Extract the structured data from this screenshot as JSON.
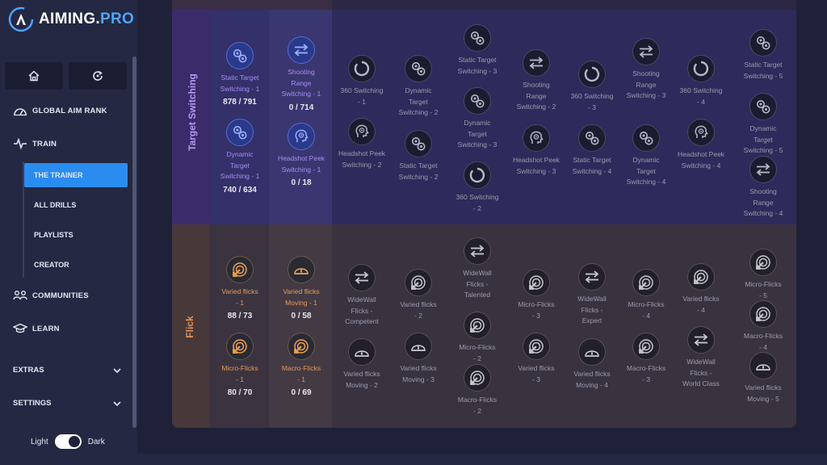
{
  "brand": {
    "name": "AIMING.",
    "suffix": "PRO"
  },
  "nav": {
    "global_aim_rank": "GLOBAL AIM RANK",
    "train": "TRAIN",
    "the_trainer": "THE TRAINER",
    "all_drills": "ALL DRILLS",
    "playlists": "PLAYLISTS",
    "creator": "CREATOR",
    "communities": "COMMUNITIES",
    "learn": "LEARN",
    "extras": "EXTRAS",
    "settings": "SETTINGS"
  },
  "theme": {
    "light": "Light",
    "dark": "Dark"
  },
  "rows": {
    "target_switching": "Target Switching",
    "flick": "Flick"
  },
  "drills": {
    "ts1": {
      "name": "Static Target Switching - 1",
      "score": "878 / 791"
    },
    "ts2": {
      "name": "Dynamic Target Switching - 1",
      "score": "740 / 634"
    },
    "ts3": {
      "name": "Shooting Range Switching - 1",
      "score": "0 / 714"
    },
    "ts4": {
      "name": "Headshot Peek Switching - 1",
      "score": "0 / 18"
    },
    "ts5": {
      "name": "360 Switching - 1"
    },
    "ts6": {
      "name": "Headshot Peek Switching - 2"
    },
    "ts7": {
      "name": "Dynamic Target Switching - 2"
    },
    "ts8": {
      "name": "Static Target Switching - 2"
    },
    "ts9": {
      "name": "Static Target Switching - 3"
    },
    "ts10": {
      "name": "Dynamic Target Switching - 3"
    },
    "ts11": {
      "name": "360 Switching - 2"
    },
    "ts12": {
      "name": "Shooting Range Switching - 2"
    },
    "ts13": {
      "name": "Headshot Peek Switching - 3"
    },
    "ts14": {
      "name": "360 Switching - 3"
    },
    "ts15": {
      "name": "Static Target Switching - 4"
    },
    "ts16": {
      "name": "Shooting Range Switching - 3"
    },
    "ts17": {
      "name": "Dynamic Target Switching - 4"
    },
    "ts18": {
      "name": "360 Switching - 4"
    },
    "ts19": {
      "name": "Headshot Peek Switching - 4"
    },
    "ts20": {
      "name": "Static Target Switching - 5"
    },
    "ts21": {
      "name": "Dynamic Target Switching - 5"
    },
    "ts22": {
      "name": "Shooting Range Switching - 4"
    },
    "fl1": {
      "name": "Varied flicks - 1",
      "score": "88 / 73"
    },
    "fl2": {
      "name": "Micro-Flicks - 1",
      "score": "80 / 70"
    },
    "fl3": {
      "name": "Varied flicks Moving - 1",
      "score": "0 / 58"
    },
    "fl4": {
      "name": "Macro-Flicks - 1",
      "score": "0 / 69"
    },
    "fl5": {
      "name": "WideWall Flicks - Competent"
    },
    "fl6": {
      "name": "Varied flicks Moving - 2"
    },
    "fl7": {
      "name": "Varied flicks - 2"
    },
    "fl8": {
      "name": "Varied flicks Moving - 3"
    },
    "fl9": {
      "name": "WideWall Flicks - Talented"
    },
    "fl10": {
      "name": "Micro-Flicks - 2"
    },
    "fl11": {
      "name": "Macro-Flicks - 2"
    },
    "fl12": {
      "name": "Micro-Flicks - 3"
    },
    "fl13": {
      "name": "Varied flicks - 3"
    },
    "fl14": {
      "name": "WideWall Flicks - Expert"
    },
    "fl15": {
      "name": "Varied flicks Moving - 4"
    },
    "fl16": {
      "name": "Micro-Flicks - 4"
    },
    "fl17": {
      "name": "Macro-Flicks - 3"
    },
    "fl18": {
      "name": "Varied flicks - 4"
    },
    "fl19": {
      "name": "WideWall Flicks - World Class"
    },
    "fl20": {
      "name": "Micro-Flicks - 5"
    },
    "fl21": {
      "name": "Macro-Flicks - 4"
    },
    "fl22": {
      "name": "Varied flicks Moving - 5"
    }
  },
  "colors": {
    "accent": "#2b8cf0",
    "ts_label": "#b89af2",
    "flick_label": "#e6935a"
  }
}
